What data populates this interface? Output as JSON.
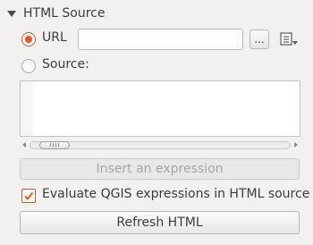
{
  "section": {
    "title": "HTML Source",
    "expanded": true
  },
  "url": {
    "label": "URL",
    "selected": true,
    "value": "",
    "browse_label": "...",
    "expression_icon": "expression-dropdown-icon"
  },
  "source": {
    "label": "Source:",
    "selected": false,
    "text": ""
  },
  "insert_expression": {
    "label": "Insert an expression",
    "enabled": false
  },
  "evaluate": {
    "label": "Evaluate QGIS expressions in HTML source",
    "checked": true
  },
  "refresh": {
    "label": "Refresh HTML"
  },
  "colors": {
    "accent": "#e9581f",
    "background": "#f2f1f0"
  }
}
